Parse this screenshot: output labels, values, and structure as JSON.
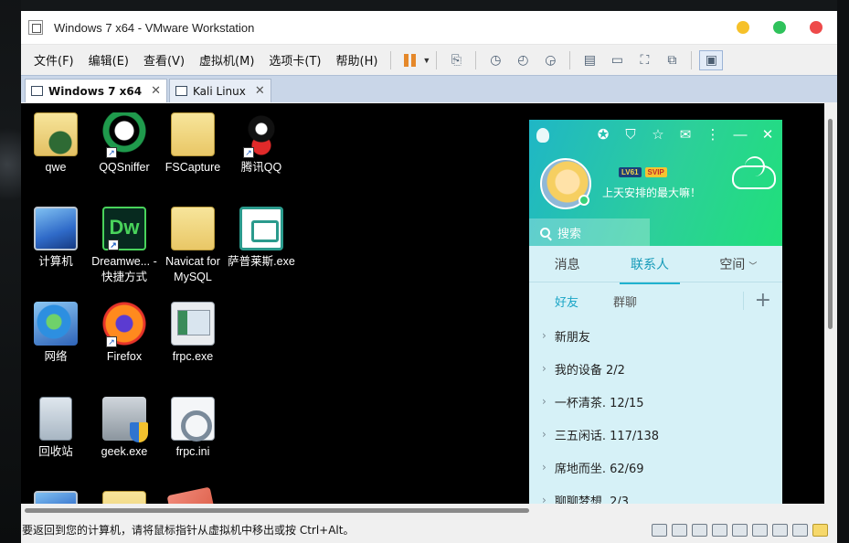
{
  "window": {
    "title": "Windows 7 x64 - VMware Workstation"
  },
  "menu": [
    "文件(F)",
    "编辑(E)",
    "查看(V)",
    "虚拟机(M)",
    "选项卡(T)",
    "帮助(H)"
  ],
  "tabs": [
    {
      "label": "Windows 7 x64",
      "active": true
    },
    {
      "label": "Kali Linux",
      "active": false
    }
  ],
  "desktop": {
    "icons": [
      {
        "label": "qwe"
      },
      {
        "label": "QQSniffer"
      },
      {
        "label": "FSCapture"
      },
      {
        "label": "腾讯QQ"
      },
      {
        "label": "计算机"
      },
      {
        "label": "Dreamwe... - 快捷方式"
      },
      {
        "label": "Navicat for MySQL"
      },
      {
        "label": "萨普莱斯.exe"
      },
      {
        "label": "网络"
      },
      {
        "label": "Firefox"
      },
      {
        "label": "frpc.exe"
      },
      {
        "label": "回收站"
      },
      {
        "label": "geek.exe"
      },
      {
        "label": "frpc.ini"
      }
    ]
  },
  "qq": {
    "level_badge": "LV61",
    "vip_badge": "SVIP",
    "signature": "上天安排的最大嘛！",
    "search_placeholder": "搜索",
    "tabs": [
      "消息",
      "联系人",
      "空间"
    ],
    "subtabs": [
      "好友",
      "群聊"
    ],
    "groups": [
      "新朋友",
      "我的设备 2/2",
      "一杯清茶. 12/15",
      "三五闲话. 117/138",
      "席地而坐. 62/69",
      "聊聊梦想. 2/3"
    ]
  },
  "status": {
    "text": "要返回到您的计算机，请将鼠标指针从虚拟机中移出或按 Ctrl+Alt。"
  },
  "colors": {
    "accent_qq": "#20b2cf",
    "pause": "#e5882a"
  }
}
